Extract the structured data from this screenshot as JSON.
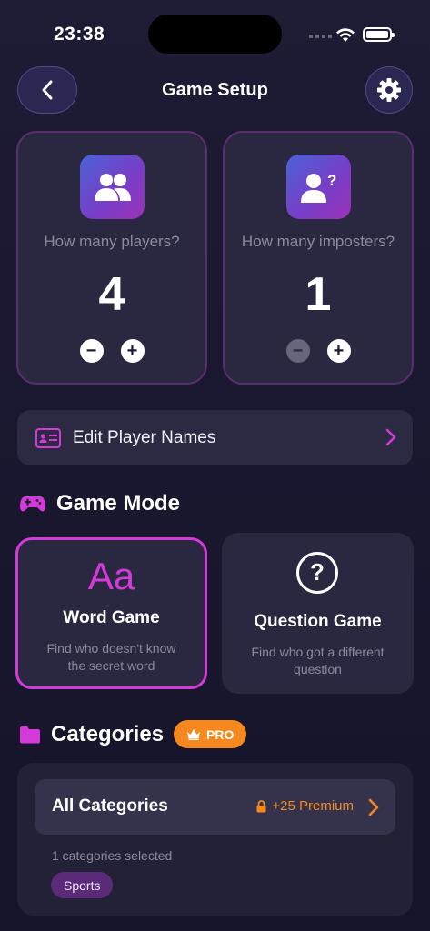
{
  "status_bar": {
    "time": "23:38"
  },
  "header": {
    "title": "Game Setup"
  },
  "players_card": {
    "question": "How many players?",
    "value": "4"
  },
  "imposters_card": {
    "question": "How many imposters?",
    "value": "1"
  },
  "stepper": {
    "minus": "−",
    "plus": "+"
  },
  "edit_names": {
    "label": "Edit Player Names"
  },
  "game_mode": {
    "title": "Game Mode",
    "word_game": {
      "glyph": "Aa",
      "title": "Word Game",
      "description": "Find who doesn't know the secret word"
    },
    "question_game": {
      "glyph": "?",
      "title": "Question Game",
      "description": "Find who got a different question"
    }
  },
  "categories": {
    "title": "Categories",
    "pro_badge": "PRO",
    "all_label": "All Categories",
    "premium": "+25 Premium",
    "selected_text": "1 categories selected",
    "chips": [
      "Sports"
    ]
  },
  "colors": {
    "accent": "#d43ad9",
    "pro": "#f5891f",
    "background": "#1e1b35"
  }
}
